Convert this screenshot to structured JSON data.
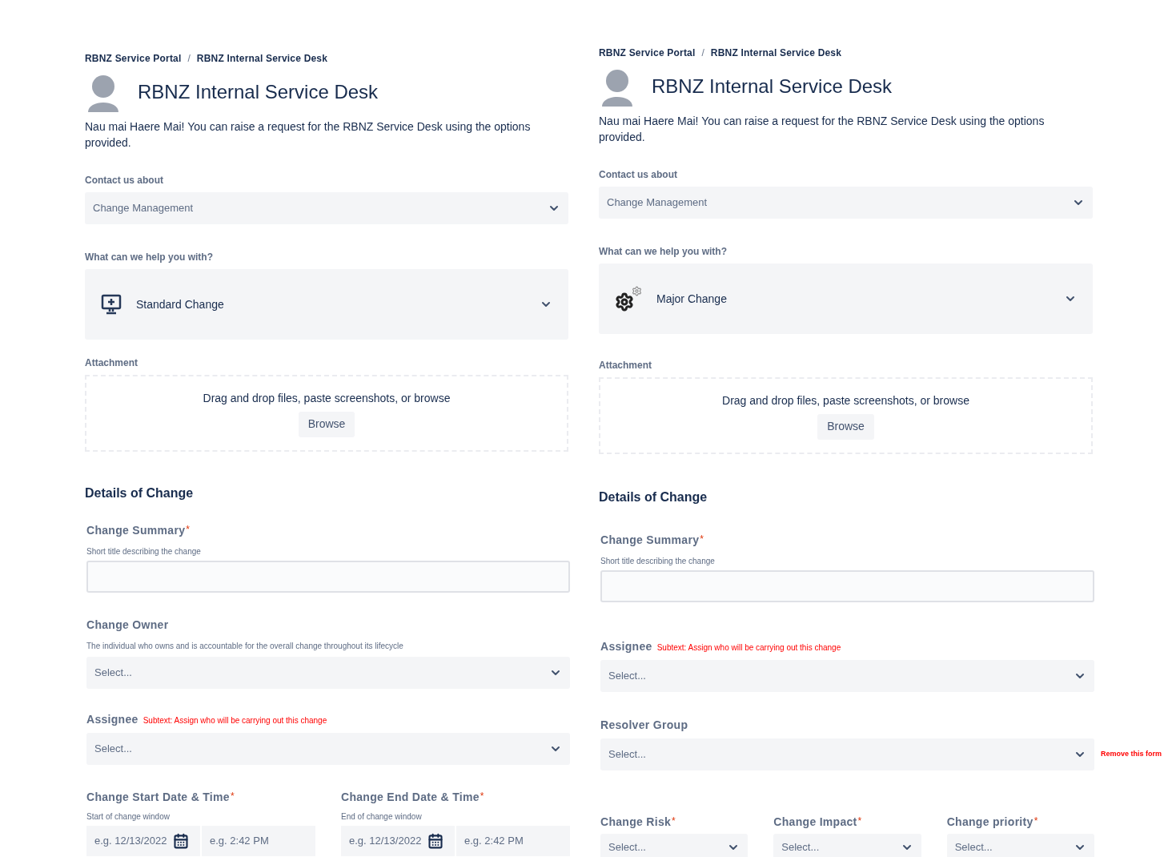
{
  "panels": [
    {
      "breadcrumbs": [
        "RBNZ Service Portal",
        "RBNZ Internal Service Desk"
      ],
      "breadcrumb_separator": "/",
      "title": "RBNZ Internal Service Desk",
      "intro": "Nau mai Haere Mai! You can raise a request for the RBNZ Service Desk using the options provided.",
      "contact": {
        "label": "Contact us about",
        "value": "Change Management"
      },
      "request_type": {
        "label": "What can we help you with?",
        "value": "Standard Change",
        "kind": "monitor"
      },
      "attachment": {
        "label": "Attachment",
        "prompt": "Drag and drop files, paste screenshots, or browse",
        "button": "Browse"
      },
      "section": "Details of Change",
      "fields": [
        {
          "kind": "text",
          "label": "Change Summary",
          "required_mark": "*",
          "hint": "Short title describing the change"
        },
        {
          "kind": "select",
          "label": "Change Owner",
          "hint": "The individual who owns and is accountable for the overall change throughout its lifecycle",
          "placeholder": "Select..."
        },
        {
          "kind": "select",
          "label": "Assignee",
          "subtext": "Subtext: Assign who will be carrying out this change",
          "placeholder": "Select..."
        },
        {
          "kind": "datetime_row",
          "items": [
            {
              "label": "Change Start Date & Time",
              "required_mark": "*",
              "hint": "Start of change window",
              "date_placeholder": "e.g. 12/13/2022",
              "time_placeholder": "e.g. 2:42 PM"
            },
            {
              "label": "Change End Date & Time",
              "required_mark": "*",
              "hint": "End of change window",
              "date_placeholder": "e.g. 12/13/2022",
              "time_placeholder": "e.g. 2:42 PM"
            }
          ]
        }
      ]
    },
    {
      "breadcrumbs": [
        "RBNZ Service Portal",
        "RBNZ Internal Service Desk"
      ],
      "breadcrumb_separator": "/",
      "title": "RBNZ Internal Service Desk",
      "intro": "Nau mai Haere Mai! You can raise a request for the RBNZ Service Desk using the options provided.",
      "contact": {
        "label": "Contact us about",
        "value": "Change Management"
      },
      "request_type": {
        "label": "What can we help you with?",
        "value": "Major Change",
        "kind": "gears"
      },
      "attachment": {
        "label": "Attachment",
        "prompt": "Drag and drop files, paste screenshots, or browse",
        "button": "Browse"
      },
      "section": "Details of Change",
      "fields": [
        {
          "kind": "text",
          "label": "Change Summary",
          "required_mark": "*",
          "hint": "Short title describing the change"
        },
        {
          "kind": "select",
          "label": "Assignee",
          "subtext": "Subtext: Assign who will be carrying out this change",
          "placeholder": "Select..."
        },
        {
          "kind": "select",
          "label": "Resolver Group",
          "placeholder": "Select...",
          "side_note": "Remove this form"
        },
        {
          "kind": "select_row",
          "items": [
            {
              "label": "Change Risk",
              "required_mark": "*",
              "placeholder": "Select..."
            },
            {
              "label": "Change Impact",
              "required_mark": "*",
              "placeholder": "Select..."
            },
            {
              "label": "Change priority",
              "required_mark": "*",
              "placeholder": "Select..."
            }
          ]
        }
      ]
    }
  ]
}
